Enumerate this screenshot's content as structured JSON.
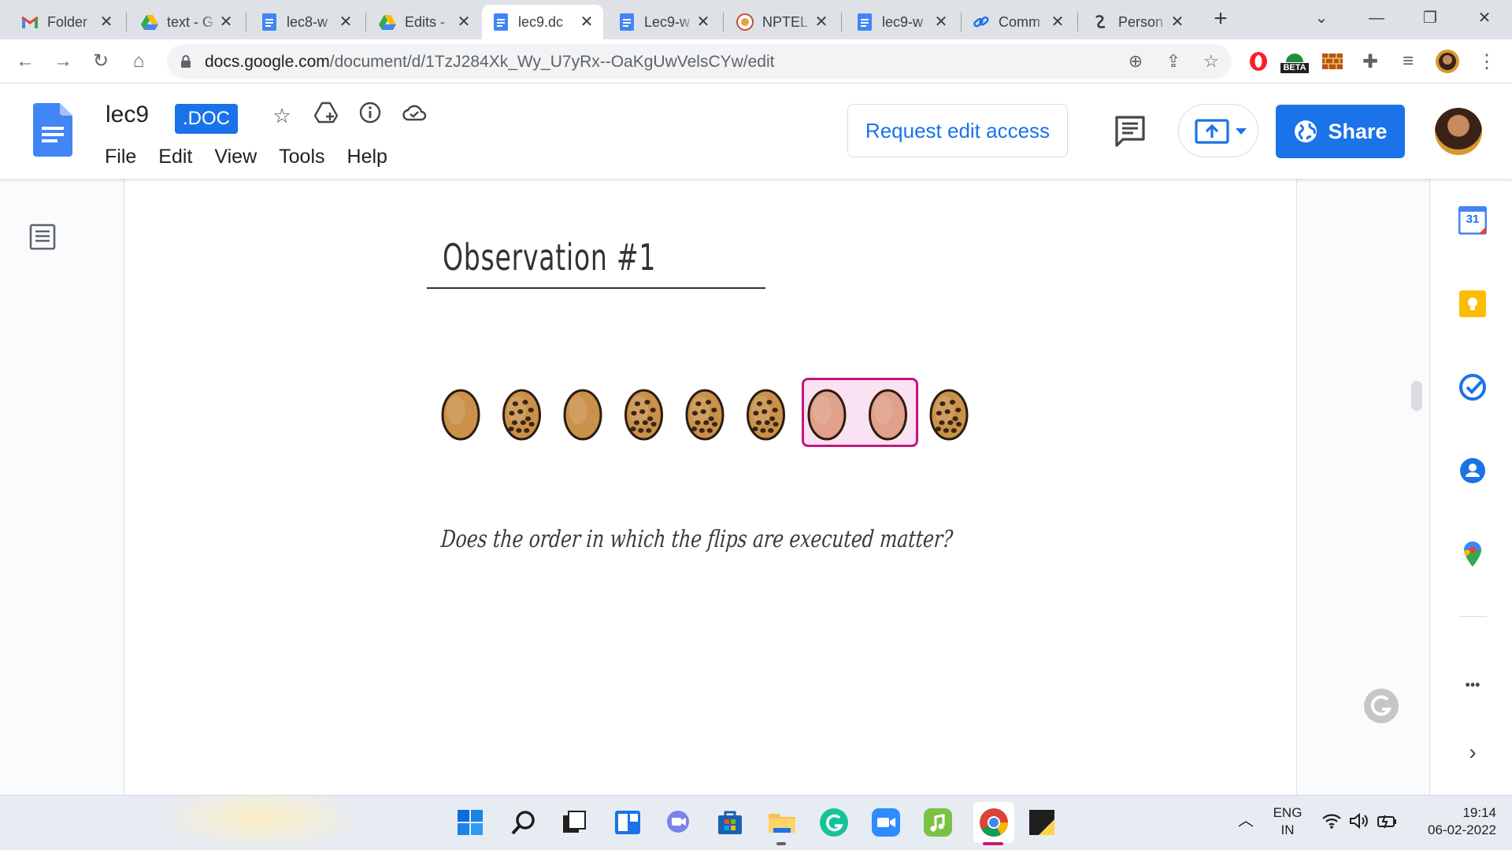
{
  "browser": {
    "tabs": [
      {
        "title": "Folder",
        "icon": "gmail-icon",
        "active": false
      },
      {
        "title": "text - G",
        "icon": "drive-icon",
        "active": false
      },
      {
        "title": "lec8-w",
        "icon": "docs-icon",
        "active": false
      },
      {
        "title": "Edits -",
        "icon": "drive-icon",
        "active": false
      },
      {
        "title": "lec9.dc",
        "icon": "docs-icon",
        "active": true
      },
      {
        "title": "Lec9-w",
        "icon": "docs-icon",
        "active": false
      },
      {
        "title": "NPTEL",
        "icon": "nptel-icon",
        "active": false
      },
      {
        "title": "lec9-w",
        "icon": "docs-icon",
        "active": false
      },
      {
        "title": "Comm",
        "icon": "link-icon",
        "active": false
      },
      {
        "title": "Person",
        "icon": "persona-icon",
        "active": false
      }
    ],
    "url_host": "docs.google.com",
    "url_path": "/document/d/1TzJ284Xk_Wy_U7yRx--OaKgUwVelsCYw/edit",
    "extension_beta_label": "BETA"
  },
  "docs": {
    "title": "lec9",
    "badge": ".DOC",
    "menu": [
      "File",
      "Edit",
      "View",
      "Tools",
      "Help"
    ],
    "request_access_label": "Request edit access",
    "share_label": "Share"
  },
  "document": {
    "heading": "Observation #1",
    "items": [
      {
        "kind": "plain",
        "highlighted": false
      },
      {
        "kind": "chip",
        "highlighted": false
      },
      {
        "kind": "plain",
        "highlighted": false
      },
      {
        "kind": "chip",
        "highlighted": false
      },
      {
        "kind": "chip",
        "highlighted": false
      },
      {
        "kind": "chip",
        "highlighted": false
      },
      {
        "kind": "plain",
        "highlighted": true
      },
      {
        "kind": "plain",
        "highlighted": true
      },
      {
        "kind": "chip",
        "highlighted": false
      }
    ],
    "question": "Does the order in which the flips are executed matter?"
  },
  "side_panel": {
    "calendar_day": "31",
    "more_label": "•••",
    "expand_label": "›"
  },
  "taskbar": {
    "lang_top": "ENG",
    "lang_bottom": "IN",
    "time": "19:14",
    "date": "06-02-2022"
  },
  "colors": {
    "accent": "#1a73e8",
    "highlight_border": "#c2187e",
    "highlight_fill": "#fbe2f2",
    "cookie": "#c9914a",
    "cookie_flipped": "#e0a089"
  }
}
